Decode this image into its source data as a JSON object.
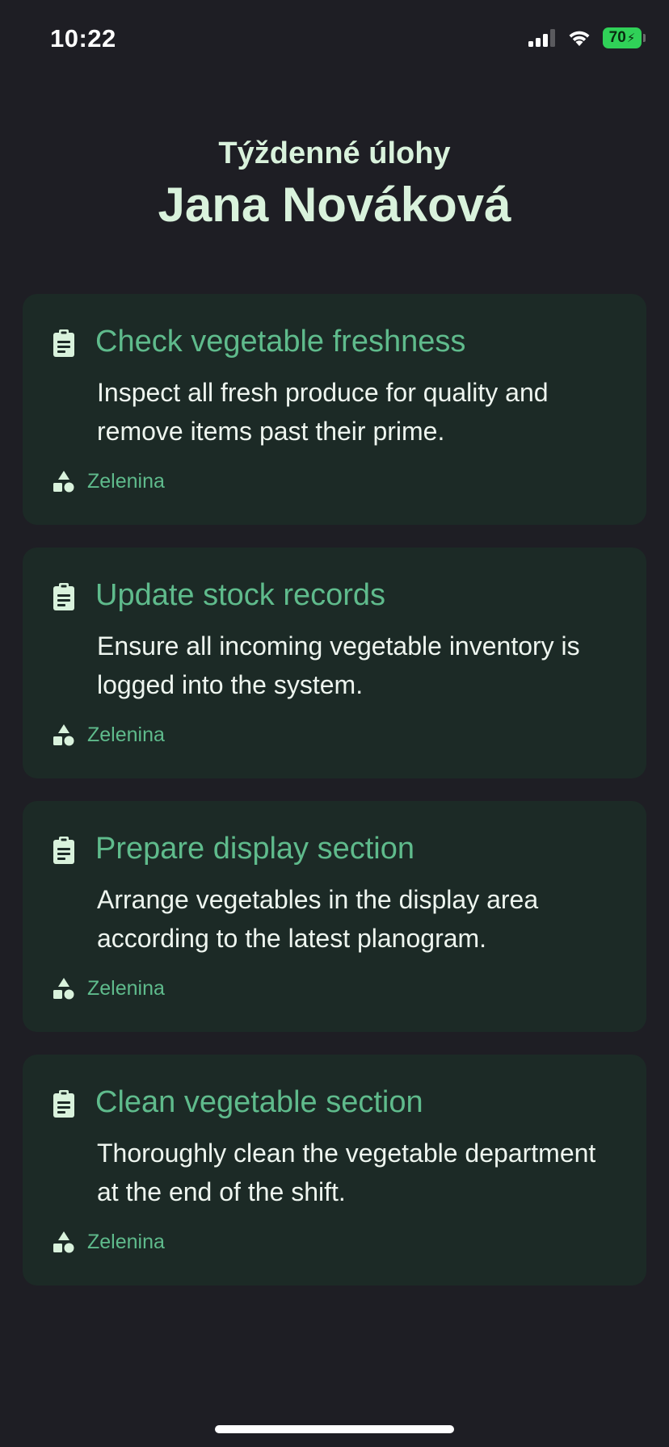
{
  "status_bar": {
    "time": "10:22",
    "battery_level": "70",
    "icons": [
      "signal-icon",
      "wifi-icon",
      "battery-icon"
    ]
  },
  "header": {
    "subtitle": "Týždenné úlohy",
    "title": "Jana Nováková"
  },
  "tasks": [
    {
      "title": "Check vegetable freshness",
      "description": "Inspect all fresh produce for quality and remove items past their prime.",
      "category": "Zelenina"
    },
    {
      "title": "Update stock records",
      "description": "Ensure all incoming vegetable inventory is logged into the system.",
      "category": "Zelenina"
    },
    {
      "title": "Prepare display section",
      "description": "Arrange vegetables in the display area according to the latest planogram.",
      "category": "Zelenina"
    },
    {
      "title": "Clean vegetable section",
      "description": "Thoroughly clean the vegetable department at the end of the shift.",
      "category": "Zelenina"
    }
  ],
  "colors": {
    "background": "#1e1e24",
    "card": "#1c2a26",
    "accent": "#5fbb8c",
    "heading": "#d9f2dc",
    "battery": "#30d158"
  }
}
